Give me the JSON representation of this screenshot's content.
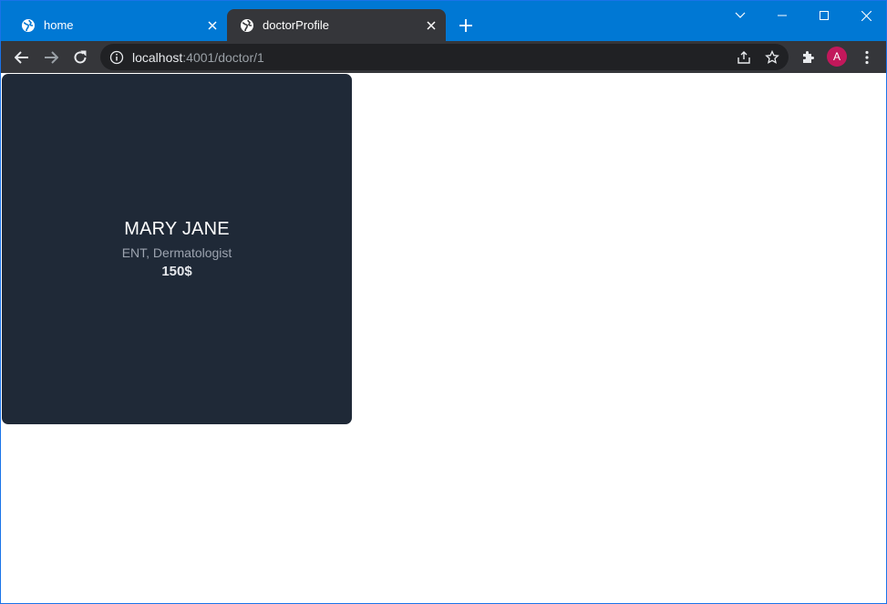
{
  "tabs": [
    {
      "title": "home",
      "icon": "globe-icon",
      "active": false
    },
    {
      "title": "doctorProfile",
      "icon": "globe-icon",
      "active": true
    }
  ],
  "address_bar": {
    "host": "localhost",
    "path": ":4001/doctor/1"
  },
  "profile": {
    "initial": "A",
    "color": "#c2185b"
  },
  "doctor": {
    "name": "MARY JANE",
    "specialty": "ENT, Dermatologist",
    "price": "150$"
  },
  "colors": {
    "titlebar": "#0078d4",
    "toolbar": "#35363a",
    "card": "#1f2937"
  }
}
